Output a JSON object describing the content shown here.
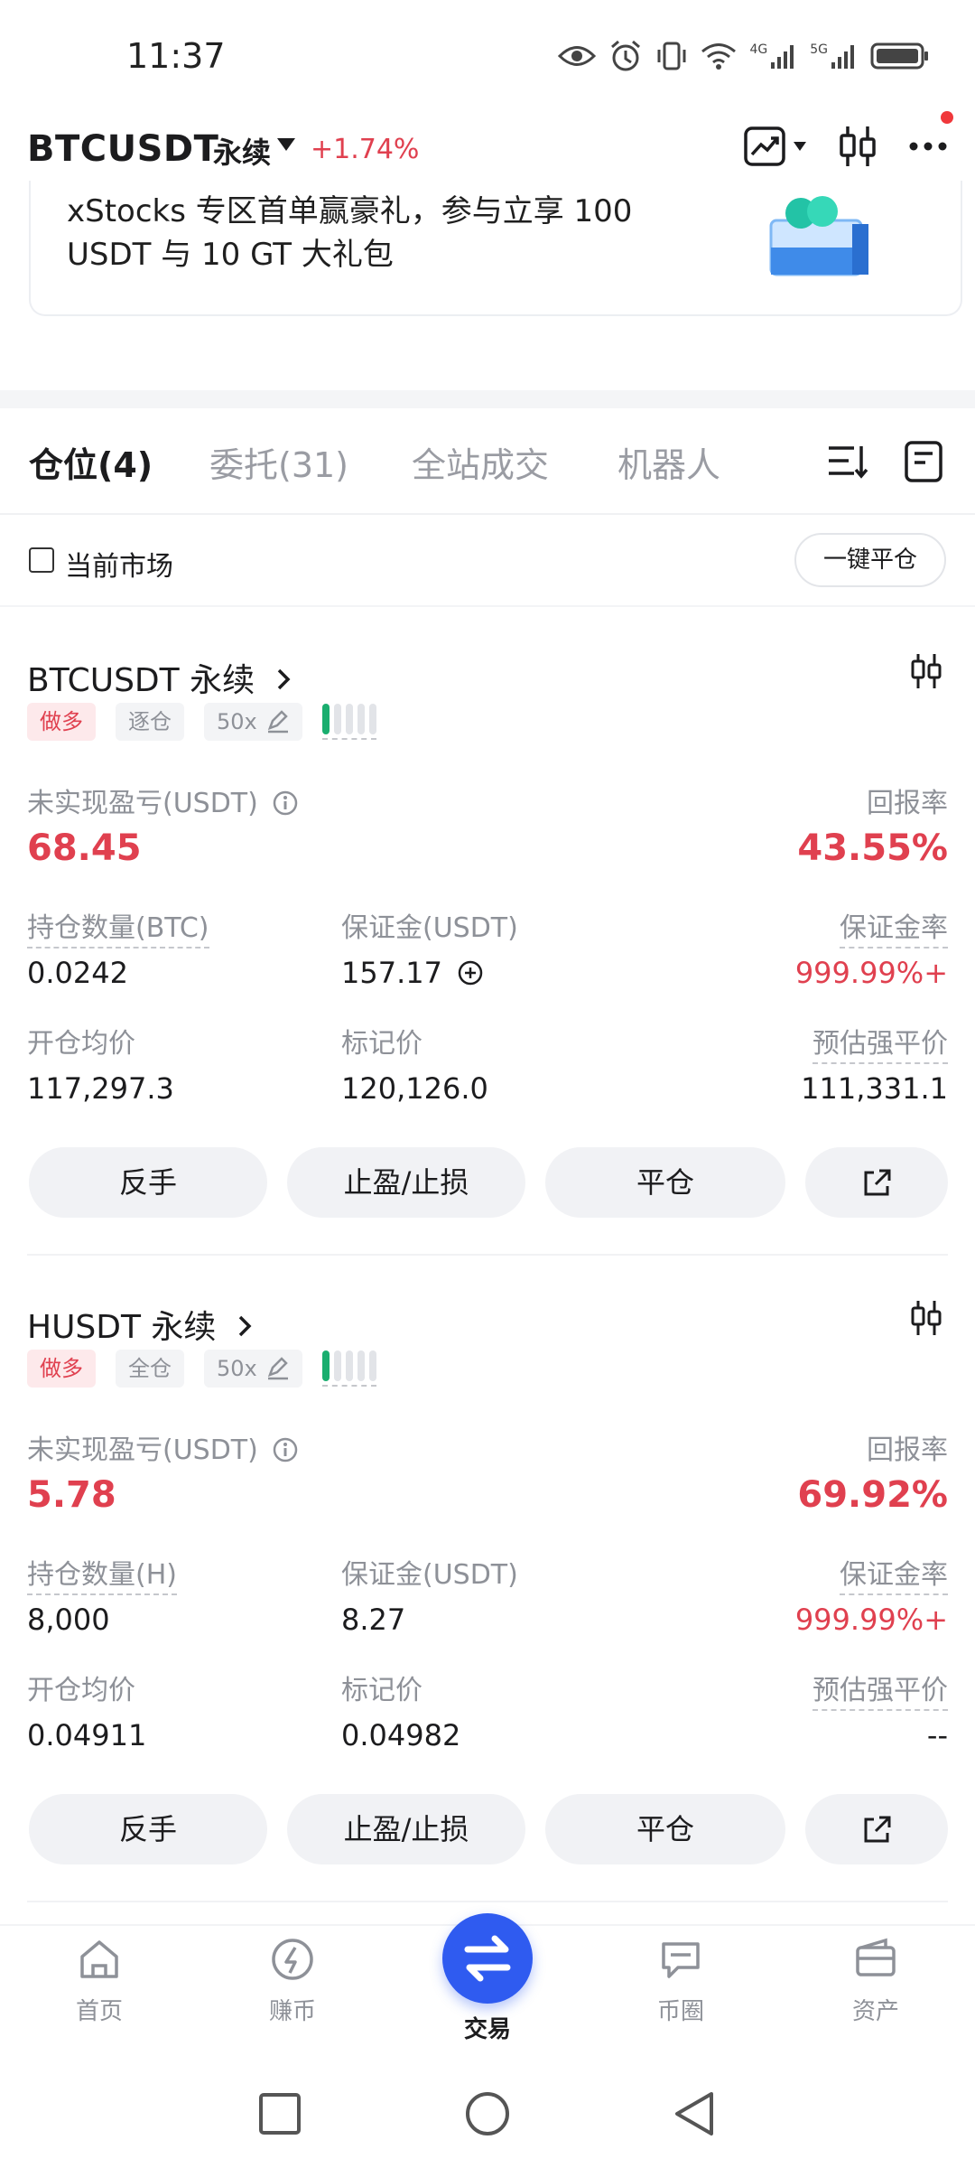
{
  "status_bar": {
    "time": "11:37",
    "net1": "4G",
    "net2": "5G"
  },
  "header": {
    "pair": "BTCUSDT",
    "type": "永续",
    "change": "+1.74%"
  },
  "banner": {
    "text": "xStocks 专区首单赢豪礼，参与立享 100 USDT 与 10 GT 大礼包"
  },
  "tabs": [
    {
      "label": "仓位(4)",
      "active": true
    },
    {
      "label": "委托(31)",
      "active": false
    },
    {
      "label": "全站成交",
      "active": false
    },
    {
      "label": "机器人",
      "active": false
    }
  ],
  "filter": {
    "current_market_label": "当前市场",
    "close_all_label": "一键平仓"
  },
  "positions": [
    {
      "title": "BTCUSDT 永续",
      "side": "做多",
      "margin_mode": "逐仓",
      "leverage": "50x",
      "risk_level": 1,
      "unrealized_pnl_label": "未实现盈亏(USDT)",
      "unrealized_pnl": "68.45",
      "roe_label": "回报率",
      "roe": "43.55%",
      "size_label": "持仓数量(BTC)",
      "size": "0.0242",
      "margin_label": "保证金(USDT)",
      "margin": "157.17",
      "margin_ratio_label": "保证金率",
      "margin_ratio": "999.99%+",
      "entry_label": "开仓均价",
      "entry": "117,297.3",
      "mark_label": "标记价",
      "mark": "120,126.0",
      "liq_label": "预估强平价",
      "liq": "111,331.1",
      "buttons": {
        "reverse": "反手",
        "tpsl": "止盈/止损",
        "close": "平仓"
      }
    },
    {
      "title": "HUSDT 永续",
      "side": "做多",
      "margin_mode": "全仓",
      "leverage": "50x",
      "risk_level": 1,
      "unrealized_pnl_label": "未实现盈亏(USDT)",
      "unrealized_pnl": "5.78",
      "roe_label": "回报率",
      "roe": "69.92%",
      "size_label": "持仓数量(H)",
      "size": "8,000",
      "margin_label": "保证金(USDT)",
      "margin": "8.27",
      "margin_ratio_label": "保证金率",
      "margin_ratio": "999.99%+",
      "entry_label": "开仓均价",
      "entry": "0.04911",
      "mark_label": "标记价",
      "mark": "0.04982",
      "liq_label": "预估强平价",
      "liq": "--",
      "buttons": {
        "reverse": "反手",
        "tpsl": "止盈/止损",
        "close": "平仓"
      }
    }
  ],
  "bottom_nav": [
    {
      "label": "首页",
      "icon": "home-icon"
    },
    {
      "label": "赚币",
      "icon": "earn-icon"
    },
    {
      "label": "交易",
      "icon": "trade-swap-icon",
      "active": true
    },
    {
      "label": "币圈",
      "icon": "square-chat-icon"
    },
    {
      "label": "资产",
      "icon": "wallet-icon"
    }
  ],
  "colors": {
    "red": "#e0404f",
    "green": "#1aae6f",
    "blue": "#2f5bf0"
  }
}
